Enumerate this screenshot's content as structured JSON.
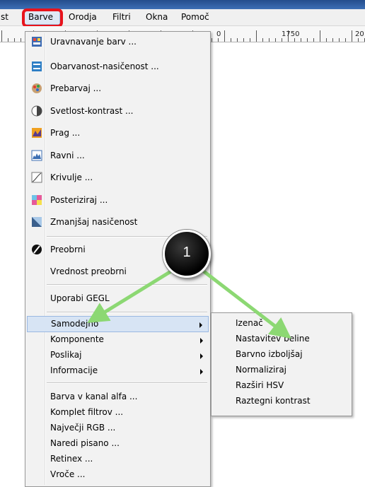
{
  "menubar": {
    "items": [
      {
        "label": "st"
      },
      {
        "label": "Barve"
      },
      {
        "label": "Orodja"
      },
      {
        "label": "Filtri"
      },
      {
        "label": "Okna"
      },
      {
        "label": "Pomoč"
      }
    ]
  },
  "ruler": {
    "labels": [
      "0",
      "1750",
      "20"
    ]
  },
  "colors_menu": {
    "items": [
      {
        "label": "Uravnavanje barv ...",
        "icon": "color-balance-icon"
      },
      {
        "label": "Obarvanost-nasičenost ...",
        "icon": "hue-saturation-icon"
      },
      {
        "label": "Prebarvaj ...",
        "icon": "colorize-icon"
      },
      {
        "label": "Svetlost-kontrast ...",
        "icon": "brightness-contrast-icon"
      },
      {
        "label": "Prag ...",
        "icon": "threshold-icon"
      },
      {
        "label": "Ravni ...",
        "icon": "levels-icon"
      },
      {
        "label": "Krivulje ...",
        "icon": "curves-icon"
      },
      {
        "label": "Posteriziraj ...",
        "icon": "posterize-icon"
      },
      {
        "label": "Zmanjšaj nasičenost",
        "icon": "desaturate-icon"
      },
      {
        "label": "Preobrni",
        "icon": "invert-icon"
      },
      {
        "label": "Vrednost preobrni"
      },
      {
        "label": "Uporabi GEGL"
      },
      {
        "label": "Samodejno",
        "submenu": true
      },
      {
        "label": "Komponente",
        "submenu": true
      },
      {
        "label": "Poslikaj",
        "submenu": true
      },
      {
        "label": "Informacije",
        "submenu": true
      },
      {
        "label": "Barva v kanal alfa ..."
      },
      {
        "label": "Komplet filtrov ..."
      },
      {
        "label": "Največji RGB ..."
      },
      {
        "label": "Naredi pisano ..."
      },
      {
        "label": "Retinex ..."
      },
      {
        "label": "Vroče ..."
      }
    ]
  },
  "auto_submenu": {
    "items": [
      {
        "label": "Izenač"
      },
      {
        "label": "Nastavitev beline"
      },
      {
        "label": "Barvno izboljšaj"
      },
      {
        "label": "Normaliziraj"
      },
      {
        "label": "Razširi HSV"
      },
      {
        "label": "Raztegni kontrast"
      }
    ]
  },
  "callout": {
    "number": "1"
  },
  "colors": {
    "highlight_red": "#e8141c",
    "arrow_green": "#8cd873",
    "hover_blue": "#d7e4f4"
  }
}
